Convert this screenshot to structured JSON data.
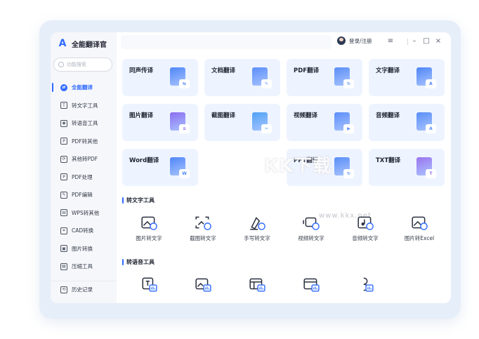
{
  "app": {
    "title": "全能翻译官",
    "logo_letter": "A"
  },
  "search": {
    "placeholder": "功能搜索"
  },
  "sidebar": {
    "items": [
      {
        "label": "全能翻译",
        "icon": "translate-icon",
        "glyph": "⇄",
        "active": true
      },
      {
        "label": "转文字工具",
        "icon": "text-tool-icon",
        "glyph": "T"
      },
      {
        "label": "转语音工具",
        "icon": "voice-tool-icon",
        "glyph": "◉"
      },
      {
        "label": "PDF转其他",
        "icon": "pdf-convert-icon",
        "glyph": "P"
      },
      {
        "label": "其他转PDF",
        "icon": "to-pdf-icon",
        "glyph": "⟳"
      },
      {
        "label": "PDF处理",
        "icon": "pdf-process-icon",
        "glyph": "P"
      },
      {
        "label": "PDF编辑",
        "icon": "pdf-edit-icon",
        "glyph": "✎"
      },
      {
        "label": "WPS转其他",
        "icon": "wps-convert-icon",
        "glyph": "W"
      },
      {
        "label": "CAD转换",
        "icon": "cad-convert-icon",
        "glyph": "⌗"
      },
      {
        "label": "图片转换",
        "icon": "image-convert-icon",
        "glyph": "▣"
      },
      {
        "label": "压缩工具",
        "icon": "compress-icon",
        "glyph": "▤"
      }
    ],
    "history": {
      "label": "历史记录",
      "icon": "history-icon",
      "glyph": "⟲"
    }
  },
  "topbar": {
    "login_label": "登录/注册",
    "menu_glyph": "≡",
    "minimize_glyph": "–",
    "maximize_glyph": "□",
    "close_glyph": "×"
  },
  "cards": [
    {
      "label": "同声传译",
      "art": "simultaneous-interpret-icon",
      "color": "#4f86f7",
      "badge": "⇆"
    },
    {
      "label": "文档翻译",
      "art": "document-translate-icon",
      "color": "#5b8dfa",
      "badge": "✎"
    },
    {
      "label": "PDF翻译",
      "art": "pdf-translate-icon",
      "color": "#5a8ef6",
      "badge": "↻"
    },
    {
      "label": "文字翻译",
      "art": "text-translate-icon",
      "color": "#4f86f7",
      "badge": "A"
    },
    {
      "label": "图片翻译",
      "art": "image-translate-icon",
      "color": "#8b6cf0",
      "badge": "≡"
    },
    {
      "label": "截图翻译",
      "art": "screenshot-translate-icon",
      "color": "#4fa2f5",
      "badge": "✂"
    },
    {
      "label": "视频翻译",
      "art": "video-translate-icon",
      "color": "#5b8dfa",
      "badge": "▶"
    },
    {
      "label": "音频翻译",
      "art": "audio-translate-icon",
      "color": "#5a8ef6",
      "badge": "A"
    },
    {
      "label": "Word翻译",
      "art": "word-translate-icon",
      "color": "#4f86f7",
      "badge": "W"
    },
    {
      "label": "PPT翻译",
      "art": "ppt-translate-icon",
      "color": "#5a8ef6",
      "badge": "↻"
    },
    {
      "label": "TXT翻译",
      "art": "txt-translate-icon",
      "color": "#9b74ee",
      "badge": "T"
    }
  ],
  "watermark": {
    "text": "KK下载",
    "url": "www.kkx.net"
  },
  "section_text": {
    "title": "转文字工具",
    "tools": [
      {
        "label": "图片转文字",
        "icon": "image-to-text-icon"
      },
      {
        "label": "截图转文字",
        "icon": "screenshot-to-text-icon"
      },
      {
        "label": "手写转文字",
        "icon": "handwriting-to-text-icon"
      },
      {
        "label": "视频转文字",
        "icon": "video-to-text-icon"
      },
      {
        "label": "音频转文字",
        "icon": "audio-to-text-icon"
      },
      {
        "label": "图片转Excel",
        "icon": "image-to-excel-icon"
      }
    ]
  },
  "section_voice": {
    "title": "转语音工具",
    "tools": [
      {
        "icon": "text-to-voice-icon"
      },
      {
        "icon": "image-to-voice-icon"
      },
      {
        "icon": "document-to-voice-icon"
      },
      {
        "icon": "screen-to-voice-icon"
      },
      {
        "icon": "speaker-voice-icon"
      }
    ]
  },
  "colors": {
    "accent": "#2f6bff",
    "card_bg": "#eef4ff",
    "icon_stroke": "#2b3140"
  }
}
